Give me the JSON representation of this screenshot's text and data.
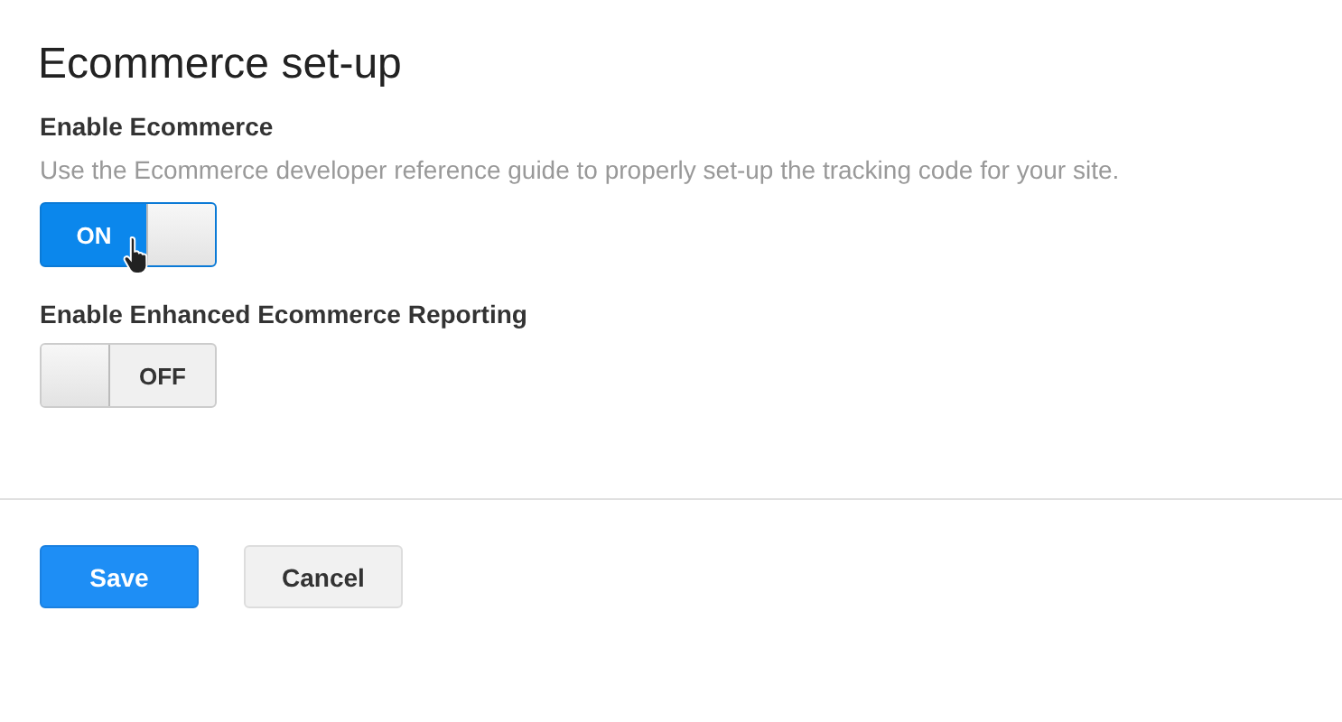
{
  "title": "Ecommerce set-up",
  "settings": [
    {
      "label": "Enable Ecommerce",
      "description": "Use the Ecommerce developer reference guide to properly set-up the tracking code for your site.",
      "on": true,
      "state_text": "ON"
    },
    {
      "label": "Enable Enhanced Ecommerce Reporting",
      "on": false,
      "state_text": "OFF"
    }
  ],
  "buttons": [
    {
      "label": "Save",
      "kind": "primary"
    },
    {
      "label": "Cancel",
      "kind": "secondary"
    }
  ]
}
